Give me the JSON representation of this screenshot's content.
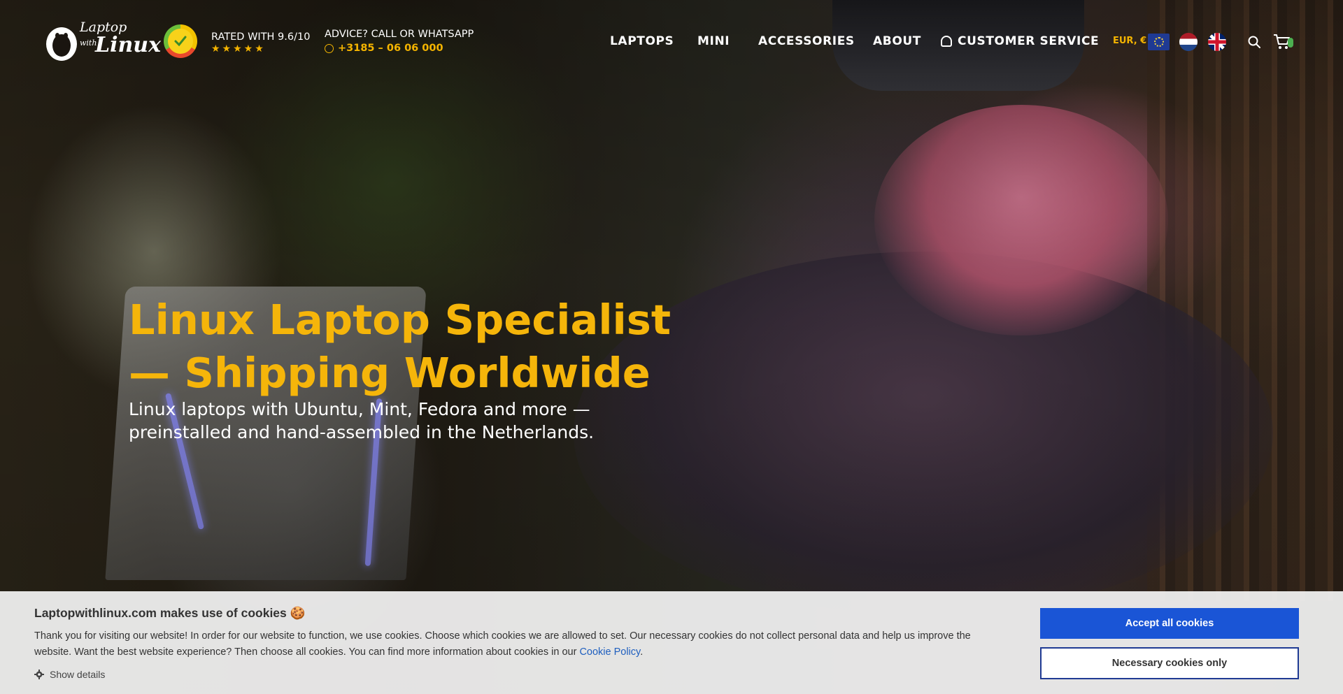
{
  "header": {
    "logo": {
      "line1": "Laptop",
      "line2": "with",
      "line3": "Linux"
    },
    "rating": {
      "text": "RATED WITH 9.6/10",
      "stars": "★★★★★"
    },
    "advice": {
      "label": "ADVICE? CALL OR WHATSAPP",
      "phone": "+3185 – 06 06 000"
    },
    "nav": {
      "laptops": "LAPTOPS",
      "mini": "MINI",
      "accessories": "ACCESSORIES",
      "about": "ABOUT",
      "customer_service": "CUSTOMER SERVICE"
    },
    "currency": "EUR, €",
    "flags": [
      "eu-flag-icon",
      "nl-flag-icon",
      "gb-flag-icon"
    ]
  },
  "hero": {
    "title": "Linux Laptop Specialist — Shipping Worldwide",
    "subtitle": "Linux laptops with Ubuntu, Mint, Fedora and more — preinstalled and hand-assembled in the Netherlands."
  },
  "cookie": {
    "title": "Laptopwithlinux.com makes use of cookies 🍪",
    "body": "Thank you for visiting our website! In order for our website to function, we use cookies. Choose which cookies we are allowed to set. Our necessary cookies do not collect personal data and help us improve the website. Want the best website experience? Then choose all cookies. You can find more information about cookies in our ",
    "link": "Cookie Policy",
    "link_suffix": ".",
    "details": "Show details",
    "accept_label": "Accept all cookies",
    "necessary_label": "Necessary cookies only"
  },
  "colors": {
    "accent": "#f5b50a",
    "primary_button": "#1a55d6",
    "link": "#1f5fbf"
  }
}
